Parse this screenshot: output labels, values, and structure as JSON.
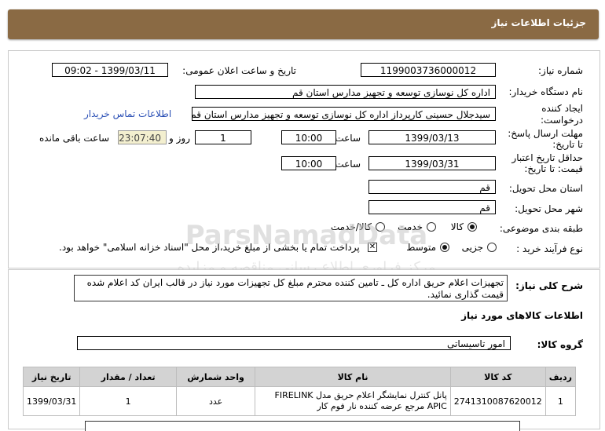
{
  "header": {
    "title": "جزئیات اطلاعات نیاز"
  },
  "form": {
    "need_number_label": "شماره نیاز:",
    "need_number": "1199003736000012",
    "announce_label": "تاریخ و ساعت اعلان عمومی:",
    "announce_value": "1399/03/11 - 09:02",
    "buyer_label": "نام دستگاه خریدار:",
    "buyer_value": "اداره کل نوسازی توسعه و تجهیز مدارس استان قم",
    "creator_label_1": "ایجاد کننده",
    "creator_label_2": "درخواست:",
    "creator_value": "سیدجلال حسینی کارپرداز اداره کل نوسازی توسعه و تجهیز مدارس استان قم",
    "contact_link": "اطلاعات تماس خریدار",
    "deadline_label_1": "مهلت ارسال پاسخ:",
    "deadline_label_2": "تا تاریخ:",
    "deadline_date": "1399/03/13",
    "time_label": "ساعت",
    "deadline_time": "10:00",
    "days_value": "1",
    "days_label": "روز و",
    "remaining_time": "23:07:40",
    "remaining_label": "ساعت باقی مانده",
    "validity_label_1": "حداقل تاریخ اعتبار",
    "validity_label_2": "قیمت: تا تاریخ:",
    "validity_date": "1399/03/31",
    "validity_time": "10:00",
    "province_label": "استان محل تحویل:",
    "province_value": "قم",
    "city_label": "شهر محل تحویل:",
    "city_value": "قم",
    "category_label": "طبقه بندی موضوعی:",
    "category_options": [
      "کالا",
      "خدمت",
      "کالا/خدمت"
    ],
    "process_label": "نوع فرآیند خرید :",
    "process_options": [
      "جزیی",
      "متوسط"
    ],
    "payment_note": "پرداخت تمام یا بخشی از مبلغ خرید،از محل \"اسناد خزانه اسلامی\" خواهد بود."
  },
  "description": {
    "label": "شرح کلی نیاز:",
    "text": "تجهیزات  اعلام حریق اداره کل ـ تامین کننده محترم مبلغ کل تجهیزات مورد نیاز در قالب ایران کد اعلام شده قیمت گذاری نمائید."
  },
  "goods": {
    "section_title": "اطلاعات کالاهای مورد نیاز",
    "group_label": "گروه کالا:",
    "group_value": "امور تاسیساتی",
    "columns": [
      "ردیف",
      "کد کالا",
      "نام کالا",
      "واحد شمارش",
      "تعداد / مقدار",
      "تاریخ نیاز"
    ],
    "rows": [
      {
        "row": "1",
        "code": "2741310087620012",
        "name": "پانل کنترل نمایشگر اعلام حریق مدل FIRELINK APIC مرجع عرضه کننده نار فوم کار",
        "unit": "عدد",
        "qty": "1",
        "date": "1399/03/31"
      }
    ]
  },
  "watermark": {
    "line1": "ParsNamadData",
    "line2": "مرکز فراوری اطلاع رسانی مناقصه و مزایده"
  },
  "colors": {
    "header": "#8a6a44",
    "link": "#2a4fb5",
    "timer_bg": "#f3efcf",
    "table_header": "#d3d3d3"
  }
}
